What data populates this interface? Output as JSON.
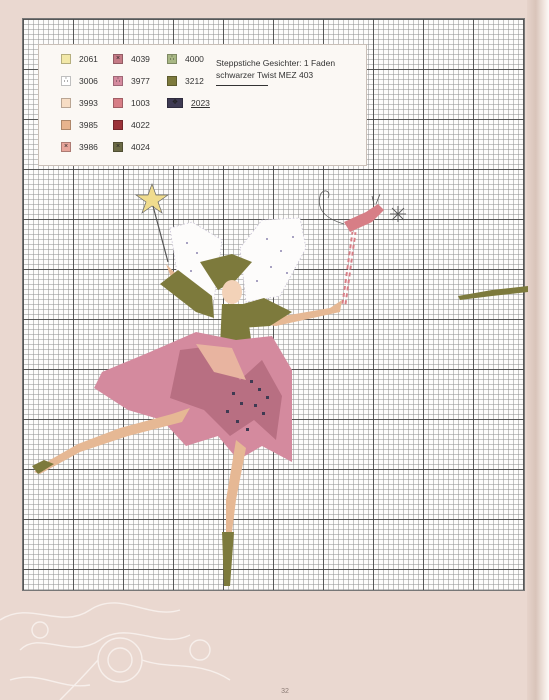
{
  "legend": {
    "items": [
      {
        "code": "2061",
        "color": "#f2e8a8",
        "symbol": ""
      },
      {
        "code": "3006",
        "color": "#ffffff",
        "symbol": "∴"
      },
      {
        "code": "3993",
        "color": "#f7ddc4",
        "symbol": ""
      },
      {
        "code": "3985",
        "color": "#e8b48e",
        "symbol": ""
      },
      {
        "code": "3986",
        "color": "#e7a59a",
        "symbol": "×"
      },
      {
        "code": "4039",
        "color": "#c57b86",
        "symbol": "×"
      },
      {
        "code": "3977",
        "color": "#d48a9e",
        "symbol": "∴"
      },
      {
        "code": "1003",
        "color": "#d77e86",
        "symbol": ""
      },
      {
        "code": "4022",
        "color": "#9b3238",
        "symbol": ""
      },
      {
        "code": "4024",
        "color": "#6b6a45",
        "symbol": "×"
      },
      {
        "code": "4000",
        "color": "#a8b784",
        "symbol": "∴"
      },
      {
        "code": "3212",
        "color": "#7d7a3c",
        "symbol": ""
      },
      {
        "code": "2023",
        "color": "#3e3a52",
        "symbol": "❖",
        "underline": true
      }
    ],
    "note": "Steppstiche Gesichter: 1 Faden schwarzer Twist MEZ 403"
  },
  "page_number": "32"
}
